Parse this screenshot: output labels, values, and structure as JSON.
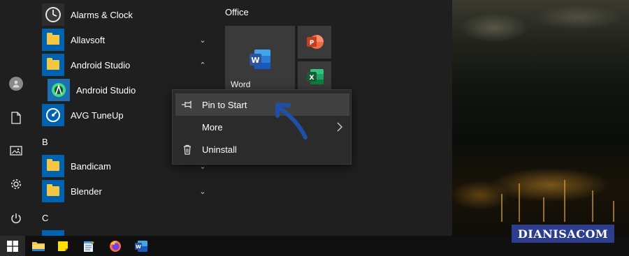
{
  "start_menu": {
    "apps": [
      {
        "name": "Alarms & Clock",
        "icon": "clock-icon"
      },
      {
        "name": "Allavsoft",
        "icon": "folder-icon",
        "expand": "collapsed"
      },
      {
        "name": "Android Studio",
        "icon": "folder-icon",
        "expand": "expanded"
      },
      {
        "name": "Android Studio",
        "icon": "android-studio-icon"
      },
      {
        "name": "AVG TuneUp",
        "icon": "avg-tuneup-icon"
      },
      {
        "name": "Bandicam",
        "icon": "folder-icon",
        "expand": "collapsed"
      },
      {
        "name": "Blender",
        "icon": "folder-icon",
        "expand": "collapsed"
      }
    ],
    "section_letters": {
      "b": "B",
      "c": "C"
    },
    "rail": [
      "user-icon",
      "documents-icon",
      "pictures-icon",
      "settings-icon",
      "power-icon"
    ]
  },
  "tiles": {
    "group_title": "Office",
    "word_label": "Word"
  },
  "context_menu": {
    "pin": "Pin to Start",
    "more": "More",
    "uninstall": "Uninstall"
  },
  "taskbar": {
    "items": [
      "windows-start-icon",
      "file-explorer-icon",
      "sticky-notes-icon",
      "notepad-icon",
      "firefox-icon",
      "word-icon"
    ]
  },
  "watermark": "DIANISACOM",
  "colors": {
    "menu_bg": "#1f1f1f",
    "context_bg": "#2b2b2b",
    "accent_blue": "#0063b1",
    "folder_yellow": "#f5c742",
    "word_blue": "#2b579a",
    "excel_green": "#217346",
    "ppt_orange": "#d24726",
    "watermark_bg": "#2d3e8e"
  }
}
